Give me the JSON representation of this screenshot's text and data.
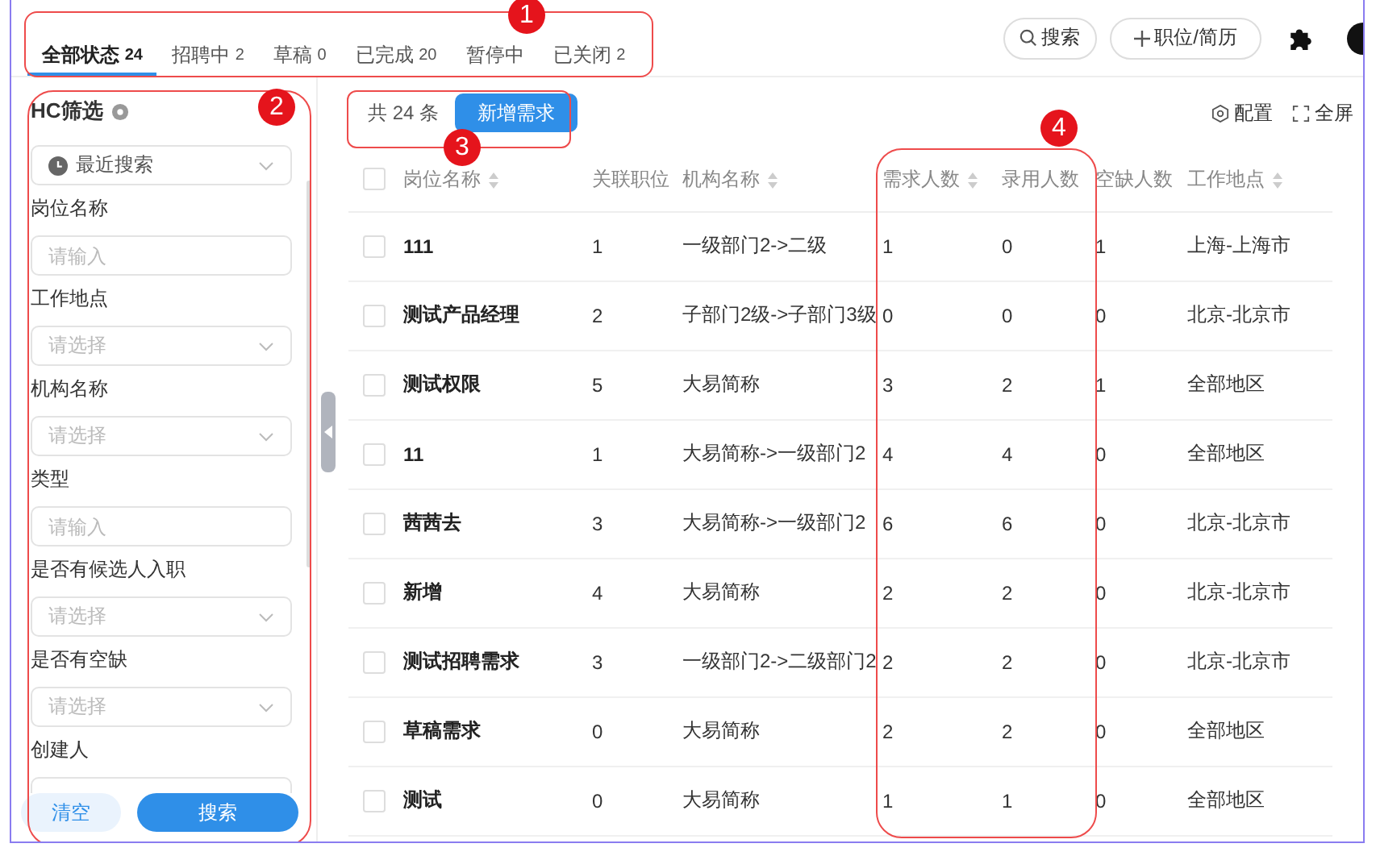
{
  "tabs": [
    {
      "label": "全部状态",
      "count": "24",
      "selected": true
    },
    {
      "label": "招聘中",
      "count": "2",
      "selected": false
    },
    {
      "label": "草稿",
      "count": "0",
      "selected": false
    },
    {
      "label": "已完成",
      "count": "20",
      "selected": false
    },
    {
      "label": "暂停中",
      "selected": false
    },
    {
      "label": "已关闭",
      "count": "2",
      "selected": false
    }
  ],
  "header_actions": {
    "search": "搜索",
    "add": "职位/简历"
  },
  "filter": {
    "title": "HC筛选",
    "recent": "最近搜索",
    "fields": [
      {
        "label": "岗位名称",
        "kind": "input",
        "placeholder": "请输入"
      },
      {
        "label": "工作地点",
        "kind": "select",
        "placeholder": "请选择"
      },
      {
        "label": "机构名称",
        "kind": "select",
        "placeholder": "请选择"
      },
      {
        "label": "类型",
        "kind": "input",
        "placeholder": "请输入"
      },
      {
        "label": "是否有候选人入职",
        "kind": "select",
        "placeholder": "请选择"
      },
      {
        "label": "是否有空缺",
        "kind": "select",
        "placeholder": "请选择"
      },
      {
        "label": "创建人",
        "kind": "input"
      }
    ],
    "buttons": {
      "clear": "清空",
      "search": "搜索"
    }
  },
  "list": {
    "total": "共 24 条",
    "new_button": "新增需求",
    "config": "配置",
    "fullscreen": "全屏"
  },
  "table": {
    "select_all_checked": false,
    "columns": [
      {
        "label": "岗位名称",
        "sortable": true
      },
      {
        "label": "关联职位",
        "sortable": false
      },
      {
        "label": "机构名称",
        "sortable": true
      },
      {
        "label": "需求人数",
        "sortable": true
      },
      {
        "label": "录用人数",
        "sortable": false
      },
      {
        "label": "空缺人数",
        "sortable": false
      },
      {
        "label": "工作地点",
        "sortable": true
      }
    ],
    "rows": [
      {
        "checked": false,
        "cells": [
          "111",
          "1",
          "一级部门2->二级",
          "1",
          "0",
          "1",
          "上海-上海市"
        ]
      },
      {
        "checked": false,
        "cells": [
          "测试产品经理",
          "2",
          "子部门2级->子部门3级",
          "0",
          "0",
          "0",
          "北京-北京市"
        ]
      },
      {
        "checked": false,
        "cells": [
          "测试权限",
          "5",
          "大易简称",
          "3",
          "2",
          "1",
          "全部地区"
        ]
      },
      {
        "checked": false,
        "cells": [
          "11",
          "1",
          "大易简称->一级部门2",
          "4",
          "4",
          "0",
          "全部地区"
        ]
      },
      {
        "checked": false,
        "cells": [
          "茜茜去",
          "3",
          "大易简称->一级部门2",
          "6",
          "6",
          "0",
          "北京-北京市"
        ]
      },
      {
        "checked": false,
        "cells": [
          "新增",
          "4",
          "大易简称",
          "2",
          "2",
          "0",
          "北京-北京市"
        ]
      },
      {
        "checked": false,
        "cells": [
          "测试招聘需求",
          "3",
          "一级部门2->二级部门2",
          "2",
          "2",
          "0",
          "北京-北京市"
        ]
      },
      {
        "checked": false,
        "cells": [
          "草稿需求",
          "0",
          "大易简称",
          "2",
          "2",
          "0",
          "全部地区"
        ]
      },
      {
        "checked": false,
        "cells": [
          "测试",
          "0",
          "大易简称",
          "1",
          "1",
          "0",
          "全部地区"
        ]
      }
    ]
  },
  "annotations": [
    {
      "number": "1"
    },
    {
      "number": "2"
    },
    {
      "number": "3"
    },
    {
      "number": "4"
    }
  ]
}
